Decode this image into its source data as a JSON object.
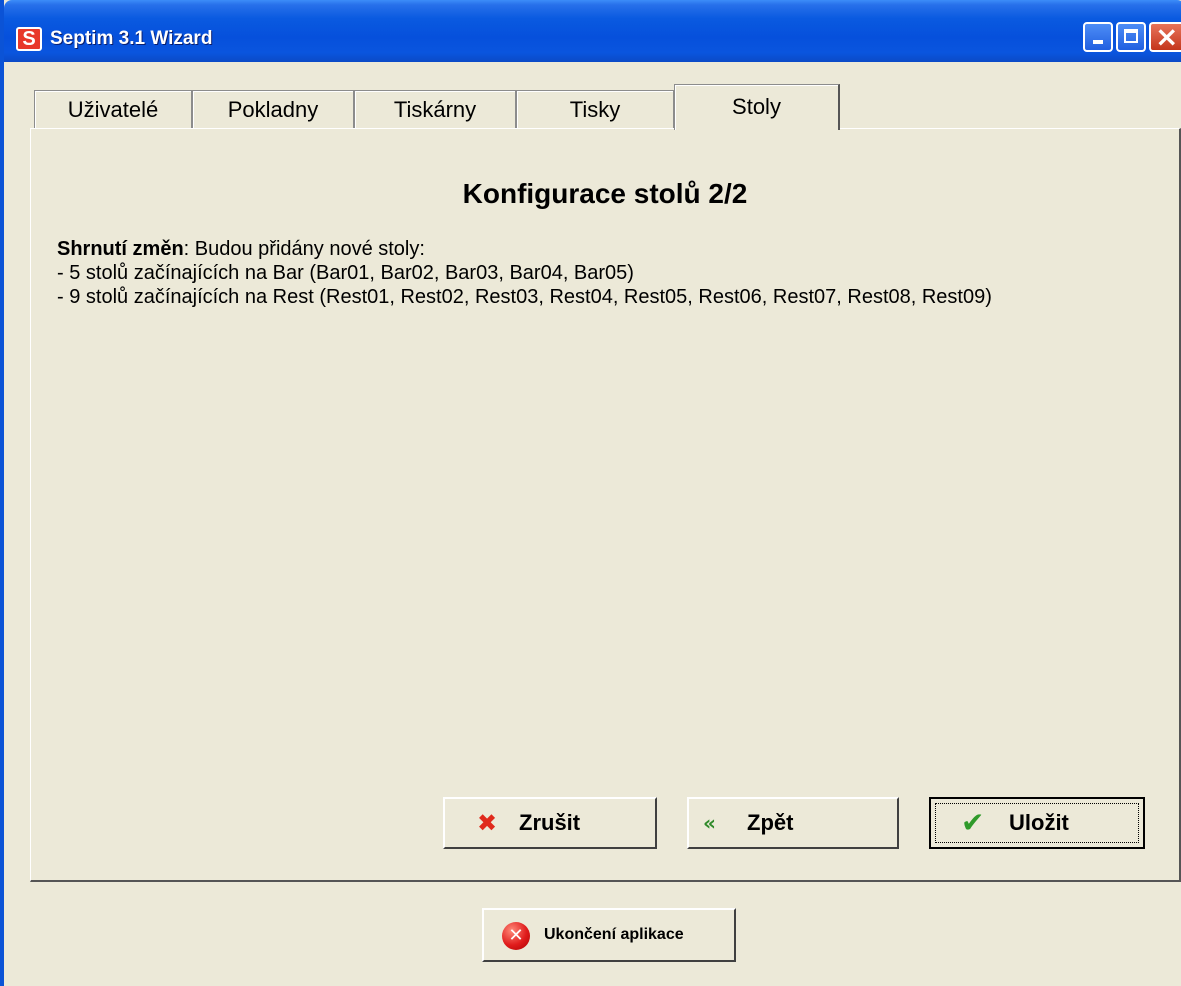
{
  "window": {
    "title": "Septim 3.1 Wizard",
    "app_icon_letter": "S"
  },
  "tabs": [
    {
      "label": "Uživatelé"
    },
    {
      "label": "Pokladny"
    },
    {
      "label": "Tiskárny"
    },
    {
      "label": "Tisky"
    },
    {
      "label": "Stoly",
      "active": true
    }
  ],
  "panel": {
    "heading": "Konfigurace stolů 2/2",
    "summary_label": "Shrnutí změn",
    "summary_intro": ": Budou přidány nové stoly:",
    "lines": [
      "- 5 stolů začínajících na Bar (Bar01, Bar02, Bar03, Bar04, Bar05)",
      "- 9 stolů začínajících na Rest (Rest01, Rest02, Rest03, Rest04, Rest05, Rest06, Rest07, Rest08, Rest09)"
    ]
  },
  "buttons": {
    "cancel": "Zrušit",
    "back": "Zpět",
    "save": "Uložit",
    "exit": "Ukončení aplikace"
  },
  "icons": {
    "cancel": "x-icon",
    "back": "double-chevron-left-icon",
    "save": "checkmark-icon",
    "exit": "stop-icon"
  },
  "colors": {
    "cancel_icon": "#e02a1c",
    "back_icon": "#2f8a2a",
    "save_icon": "#2f9a2a"
  }
}
